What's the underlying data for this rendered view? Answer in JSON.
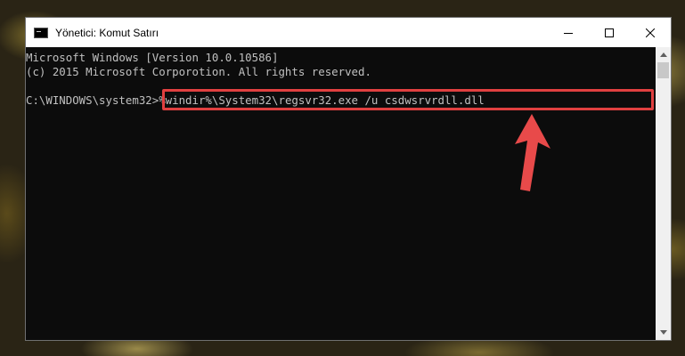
{
  "window": {
    "title": "Yönetici: Komut Satırı"
  },
  "console": {
    "lines": [
      "Microsoft Windows [Version 10.0.10586]",
      "(c) 2015 Microsoft Corporotion. All rights reserved."
    ],
    "prompt": "C:\\WINDOWS\\system32>",
    "command": "%windir%\\System32\\regsvr32.exe /u csdwsrvrdll.dll"
  },
  "colors": {
    "highlight": "#e04040",
    "console_bg": "#0c0c0c",
    "console_text": "#c0c0c0"
  },
  "icons": [
    "cmd-app-icon",
    "minimize-icon",
    "maximize-icon",
    "close-icon",
    "scroll-up-icon",
    "scroll-down-icon",
    "annotation-arrow-icon"
  ]
}
